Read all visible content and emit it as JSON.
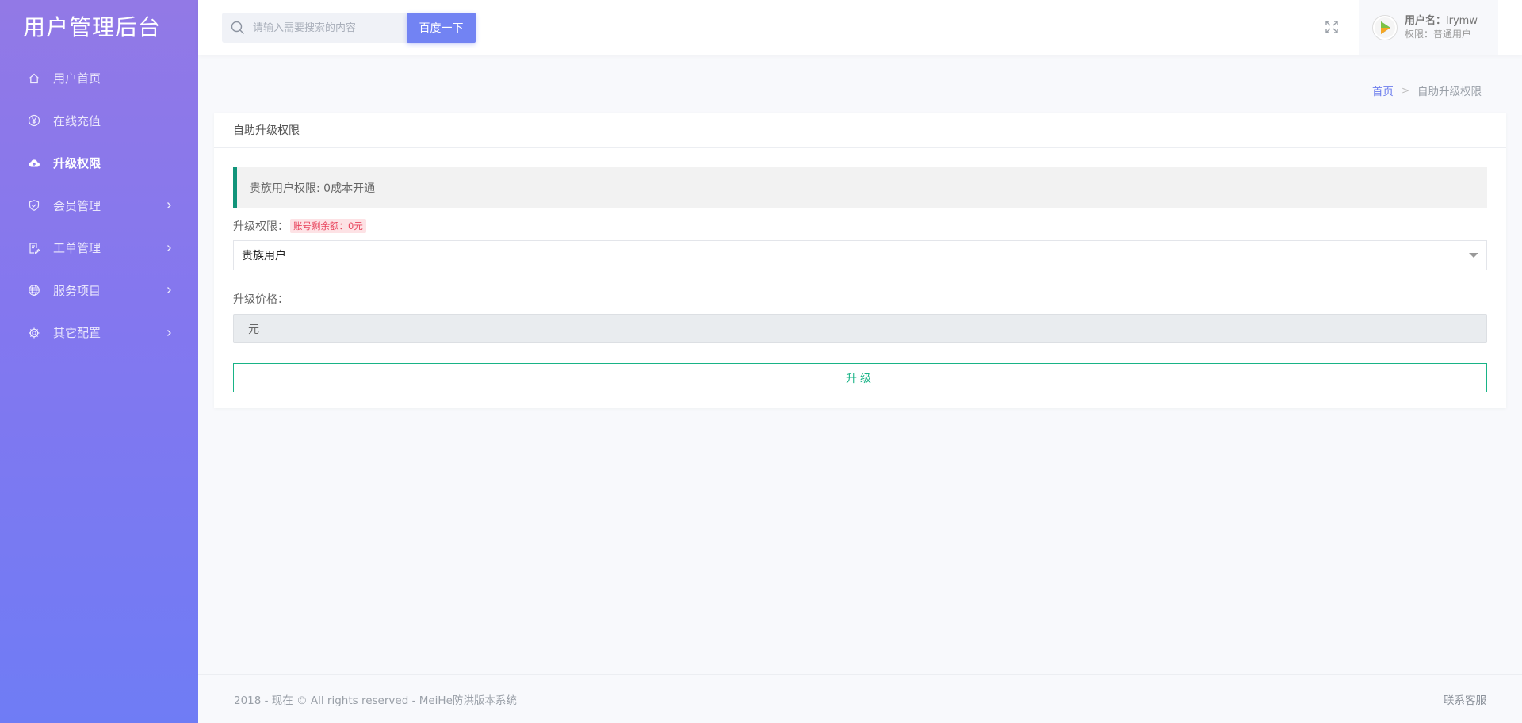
{
  "brand": {
    "title": "用户管理后台"
  },
  "sidebar": {
    "items": [
      {
        "label": "用户首页",
        "icon": "home-icon",
        "has_submenu": false
      },
      {
        "label": "在线充值",
        "icon": "yen-icon",
        "has_submenu": false
      },
      {
        "label": "升级权限",
        "icon": "cloud-upload-icon",
        "has_submenu": false,
        "active": true
      },
      {
        "label": "会员管理",
        "icon": "shield-icon",
        "has_submenu": true
      },
      {
        "label": "工单管理",
        "icon": "ticket-icon",
        "has_submenu": true
      },
      {
        "label": "服务项目",
        "icon": "globe-icon",
        "has_submenu": true
      },
      {
        "label": "其它配置",
        "icon": "gear-icon",
        "has_submenu": true
      }
    ]
  },
  "header": {
    "search": {
      "placeholder": "请输入需要搜索的内容",
      "button_label": "百度一下"
    },
    "user": {
      "name_label": "用户名：",
      "name_value": "lrymw",
      "role_label": "权限：",
      "role_value": "普通用户"
    }
  },
  "breadcrumb": {
    "home": "首页",
    "separator": ">",
    "current": "自助升级权限"
  },
  "card": {
    "title": "自助升级权限",
    "callout": "贵族用户权限: 0成本开通",
    "upgrade_label": "升级权限：",
    "balance_badge": "账号剩余额：0元",
    "select_value": "贵族用户",
    "price_label": "升级价格：",
    "price_value": "元",
    "submit_label": "升级"
  },
  "footer": {
    "copyright": "2018 - 现在 © All rights reserved - MeiHe防洪版本系统",
    "contact": "联系客服"
  },
  "colors": {
    "sidebar_top": "#9279e6",
    "sidebar_bottom": "#6f7cf5",
    "accent": "#7283f3",
    "callout_border": "#11947a",
    "submit_green": "#18b386",
    "badge_red": "#e8455d"
  }
}
